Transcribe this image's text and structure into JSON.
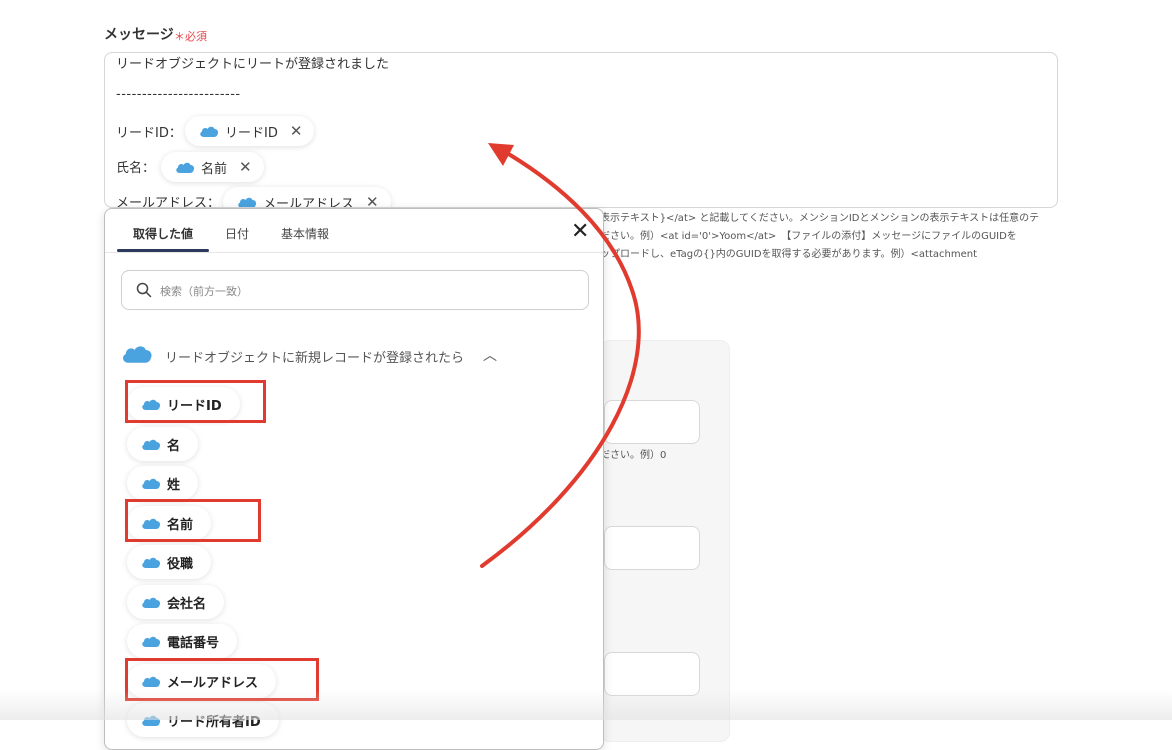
{
  "message": {
    "label": "メッセージ",
    "required_mark": "＊",
    "required_text": "必須",
    "lines": {
      "line1": "リードオブジェクトにリートが登録されました",
      "separator": "------------------------",
      "lead_id_label": "リードID：",
      "name_label": "氏名：",
      "email_label": "メールアドレス："
    },
    "chips": {
      "lead_id": "リードID",
      "name": "名前",
      "email": "メールアドレス"
    },
    "help_lines": [
      "表示テキスト}</at> と記載してください。メンションIDとメンションの表示テキストは任意のテ",
      "ださい。例）<at id='0'>Yoom</at>　【ファイルの添付】メッセージにファイルのGUIDを",
      "ップロードし、eTagの{}内のGUIDを取得する必要があります。例）<attachment"
    ]
  },
  "background_form": {
    "hint": "ださい。例）0"
  },
  "popup": {
    "tabs": [
      "取得した値",
      "日付",
      "基本情報"
    ],
    "active_tab": 0,
    "close_symbol": "✕",
    "search_placeholder": "検索（前方一致）",
    "group_title": "リードオブジェクトに新規レコードが登録されたら",
    "group_chevron": "︿",
    "items": [
      "リードID",
      "名",
      "姓",
      "名前",
      "役職",
      "会社名",
      "電話番号",
      "メールアドレス",
      "リード所有者ID"
    ],
    "highlighted_items": [
      "リードID",
      "名前",
      "メールアドレス"
    ]
  },
  "colors": {
    "salesforce_cloud": "#4aa3df",
    "highlight_red": "#e03b2e",
    "required_red": "#e5484d"
  },
  "icons": [
    "salesforce-cloud-icon",
    "close-icon",
    "search-icon",
    "chevron-up-icon",
    "arrow-annotation"
  ]
}
